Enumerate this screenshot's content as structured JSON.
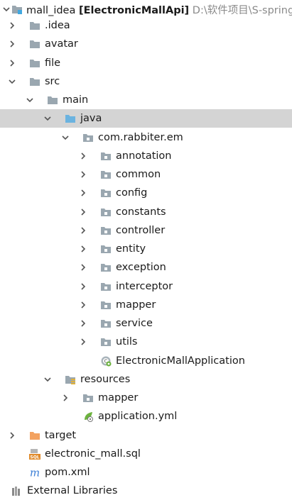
{
  "project": {
    "label": "mall_idea",
    "module_label": "[ElectronicMallApi]",
    "path": "D:\\软件项目\\S-springb"
  },
  "tree": [
    {
      "label": ".idea",
      "icon": "folder-icon",
      "arrow": "right"
    },
    {
      "label": "avatar",
      "icon": "folder-icon",
      "arrow": "right"
    },
    {
      "label": "file",
      "icon": "folder-icon",
      "arrow": "right"
    },
    {
      "label": "src",
      "icon": "folder-icon",
      "arrow": "down"
    },
    {
      "label": "main",
      "icon": "folder-icon",
      "arrow": "down"
    },
    {
      "label": "java",
      "icon": "source-folder-icon",
      "arrow": "down",
      "selected": true
    },
    {
      "label": "com.rabbiter.em",
      "icon": "package-icon",
      "arrow": "down"
    },
    {
      "label": "annotation",
      "icon": "package-icon",
      "arrow": "right"
    },
    {
      "label": "common",
      "icon": "package-icon",
      "arrow": "right"
    },
    {
      "label": "config",
      "icon": "package-icon",
      "arrow": "right"
    },
    {
      "label": "constants",
      "icon": "package-icon",
      "arrow": "right"
    },
    {
      "label": "controller",
      "icon": "package-icon",
      "arrow": "right"
    },
    {
      "label": "entity",
      "icon": "package-icon",
      "arrow": "right"
    },
    {
      "label": "exception",
      "icon": "package-icon",
      "arrow": "right"
    },
    {
      "label": "interceptor",
      "icon": "package-icon",
      "arrow": "right"
    },
    {
      "label": "mapper",
      "icon": "package-icon",
      "arrow": "right"
    },
    {
      "label": "service",
      "icon": "package-icon",
      "arrow": "right"
    },
    {
      "label": "utils",
      "icon": "package-icon",
      "arrow": "right"
    },
    {
      "label": "ElectronicMallApplication",
      "icon": "spring-boot-class-icon",
      "arrow": "none"
    },
    {
      "label": "resources",
      "icon": "resources-folder-icon",
      "arrow": "down"
    },
    {
      "label": "mapper",
      "icon": "package-icon",
      "arrow": "right"
    },
    {
      "label": "application.yml",
      "icon": "spring-config-icon",
      "arrow": "none"
    },
    {
      "label": "target",
      "icon": "excluded-folder-icon",
      "arrow": "right"
    },
    {
      "label": "electronic_mall.sql",
      "icon": "sql-file-icon",
      "arrow": "none"
    },
    {
      "label": "pom.xml",
      "icon": "maven-icon",
      "arrow": "none"
    },
    {
      "label": "External Libraries",
      "icon": "libraries-icon",
      "arrow": "right"
    }
  ],
  "colors": {
    "folder": "#9aa7b0",
    "source_folder": "#6bb3e0",
    "excluded_folder": "#f3a260",
    "selection": "#d4d4d4",
    "spring": "#6db33f",
    "maven": "#3c7fd6"
  }
}
